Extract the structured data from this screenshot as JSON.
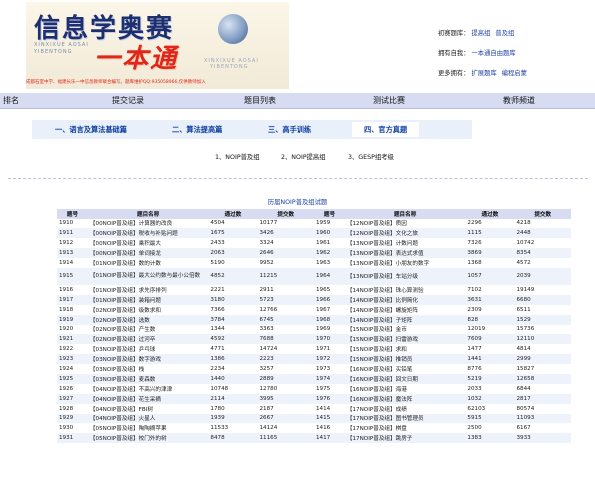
{
  "banner": {
    "title": "信息学奥赛",
    "brand": "一本通",
    "pinyin_left_1": "XINXIXUE AOSAI",
    "pinyin_left_2": "YIBENTONG",
    "pinyin_right_1": "XINXIXUE AOSAI",
    "pinyin_right_2": "YIBENTONG",
    "slogan": "成都石室中学、福建长乐一中信息教师联合编写。题库维护QQ:935058966,仅供教师加入"
  },
  "side_links": {
    "row1": {
      "label": "初赛题库：",
      "links": [
        "提高组",
        "普及组"
      ]
    },
    "row2": {
      "label": "拥有自我：",
      "links": [
        "一本通自由题库"
      ]
    },
    "row3": {
      "label": "更多拥有：",
      "links": [
        "扩展题库",
        "编程启蒙"
      ]
    }
  },
  "nav": {
    "items": [
      "排名",
      "提交记录",
      "题目列表",
      "测试比赛",
      "教师频道"
    ]
  },
  "tabs": [
    "一、语言及算法基础篇",
    "二、算法提高篇",
    "三、高手训练",
    "四、官方真题"
  ],
  "subtabs": [
    "1、NOIP普及组",
    "2、NOIP提高组",
    "3、GESP组考级"
  ],
  "table": {
    "title": "历届NOIP普及组试题",
    "headers": [
      "题号",
      "题目名称",
      "通过数",
      "提交数",
      "题号",
      "题目名称",
      "通过数",
      "提交数"
    ],
    "rows": [
      [
        "1910",
        "【00NOIP普及组】计算器的改良",
        "4504",
        "10177",
        "1959",
        "【12NOIP普及组】质因",
        "2296",
        "4218"
      ],
      [
        "1911",
        "【00NOIP普及组】税收与补贴问题",
        "1675",
        "3426",
        "1960",
        "【12NOIP普及组】文化之旅",
        "1115",
        "2448"
      ],
      [
        "1912",
        "【00NOIP普及组】乘积最大",
        "2433",
        "3324",
        "1961",
        "【13NOIP普及组】计数问题",
        "7326",
        "10742"
      ],
      [
        "1913",
        "【00NOIP普及组】单词接龙",
        "2063",
        "2646",
        "1962",
        "【13NOIP普及组】表达式求值",
        "3869",
        "8354"
      ],
      [
        "1914",
        "【01NOIP普及组】数的计数",
        "5190",
        "9952",
        "1963",
        "【13NOIP普及组】小朋友的数字",
        "1368",
        "4572"
      ],
      [
        "1915",
        "【01NOIP普及组】最大公约数与最小公倍数",
        "4852",
        "11215",
        "1964",
        "【13NOIP普及组】车站分级",
        "1057",
        "2039"
      ],
      [
        "1916",
        "【01NOIP普及组】求先序排列",
        "2221",
        "2911",
        "1965",
        "【14NOIP普及组】珠心算测验",
        "7102",
        "19149"
      ],
      [
        "1917",
        "【01NOIP普及组】装箱问题",
        "3180",
        "5723",
        "1966",
        "【14NOIP普及组】比例简化",
        "3631",
        "6680"
      ],
      [
        "1918",
        "【02NOIP普及组】级数求和",
        "7366",
        "12766",
        "1967",
        "【14NOIP普及组】螺旋矩阵",
        "2309",
        "6511"
      ],
      [
        "1919",
        "【02NOIP普及组】选数",
        "3784",
        "6745",
        "1968",
        "【14NOIP普及组】子矩阵",
        "828",
        "1529"
      ],
      [
        "1920",
        "【02NOIP普及组】产生数",
        "1344",
        "3363",
        "1969",
        "【15NOIP普及组】金币",
        "12019",
        "15736"
      ],
      [
        "1921",
        "【02NOIP普及组】过河卒",
        "4592",
        "7688",
        "1970",
        "【15NOIP普及组】扫雷游戏",
        "7609",
        "12110"
      ],
      [
        "1922",
        "【03NOIP普及组】乒乓球",
        "4771",
        "14724",
        "1971",
        "【15NOIP普及组】求和",
        "1477",
        "4814"
      ],
      [
        "1923",
        "【03NOIP普及组】数字游戏",
        "1386",
        "2223",
        "1972",
        "【15NOIP普及组】推销员",
        "1441",
        "2999"
      ],
      [
        "1924",
        "【03NOIP普及组】栈",
        "2234",
        "3257",
        "1973",
        "【16NOIP普及组】买铅笔",
        "8776",
        "15827"
      ],
      [
        "1925",
        "【03NOIP普及组】麦森数",
        "1440",
        "2889",
        "1974",
        "【16NOIP普及组】回文日期",
        "5219",
        "12658"
      ],
      [
        "1926",
        "【04NOIP普及组】不高兴的津津",
        "10748",
        "12780",
        "1975",
        "【16NOIP普及组】海港",
        "2033",
        "6844"
      ],
      [
        "1927",
        "【04NOIP普及组】花生采摘",
        "2114",
        "3995",
        "1976",
        "【16NOIP普及组】魔法阵",
        "1032",
        "2817"
      ],
      [
        "1928",
        "【04NOIP普及组】FBI树",
        "1780",
        "2187",
        "1414",
        "【17NOIP普及组】成绩",
        "62103",
        "80574"
      ],
      [
        "1929",
        "【04NOIP普及组】火星人",
        "1939",
        "2667",
        "1415",
        "【17NOIP普及组】图书管理员",
        "5915",
        "11093"
      ],
      [
        "1930",
        "【05NOIP普及组】陶陶摘苹果",
        "11533",
        "14124",
        "1416",
        "【17NOIP普及组】棋盘",
        "2500",
        "6167"
      ],
      [
        "1931",
        "【05NOIP普及组】校门外的树",
        "8478",
        "11165",
        "1417",
        "【17NOIP普及组】跳房子",
        "1383",
        "3933"
      ]
    ]
  }
}
